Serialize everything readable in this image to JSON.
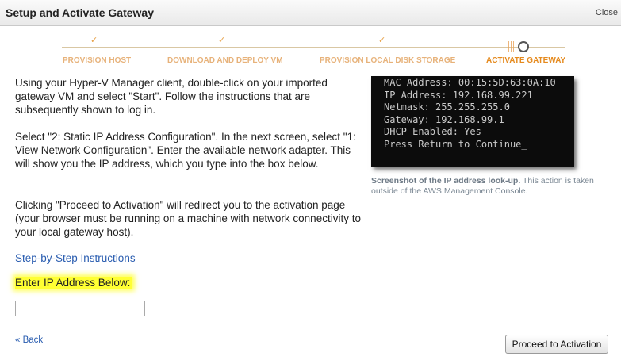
{
  "header": {
    "title": "Setup and Activate Gateway",
    "close_label": "Close"
  },
  "progress": {
    "check_glyph": "✓",
    "steps": [
      {
        "label": "PROVISION HOST",
        "status": "done"
      },
      {
        "label": "DOWNLOAD AND DEPLOY VM",
        "status": "done"
      },
      {
        "label": "PROVISION LOCAL DISK STORAGE",
        "status": "done"
      },
      {
        "label": "ACTIVATE GATEWAY",
        "status": "active"
      }
    ]
  },
  "instructions": {
    "p1": "Using your Hyper-V Manager client, double-click on your imported gateway VM and select \"Start\". Follow the instructions that are subsequently shown to log in.",
    "p2": "Select \"2: Static IP Address Configuration\". In the next screen, select \"1: View Network Configuration\". Enter the available network adapter. This will show you the IP address, which you type into the box below.",
    "p3": "Clicking \"Proceed to Activation\" will redirect you to the activation page (your browser must be running on a machine with network connectivity to your local gateway host).",
    "link": "Step-by-Step Instructions",
    "ip_label": "Enter IP Address Below:",
    "ip_value": ""
  },
  "terminal": {
    "lines": [
      "MAC Address: 00:15:5D:63:0A:10",
      "IP Address: 192.168.99.221",
      "Netmask: 255.255.255.0",
      "Gateway: 192.168.99.1",
      "DHCP Enabled: Yes",
      "",
      "Press Return to Continue_"
    ]
  },
  "caption": {
    "bold": "Screenshot of the IP address look-up.",
    "rest": " This action is taken outside of the AWS Management Console."
  },
  "footer": {
    "back_label": "« Back",
    "proceed_label": "Proceed to Activation"
  },
  "colors": {
    "highlight": "#ffff33",
    "link": "#2a5db0",
    "step_active": "#e58a1e",
    "terminal_box": "#d42a2a"
  }
}
